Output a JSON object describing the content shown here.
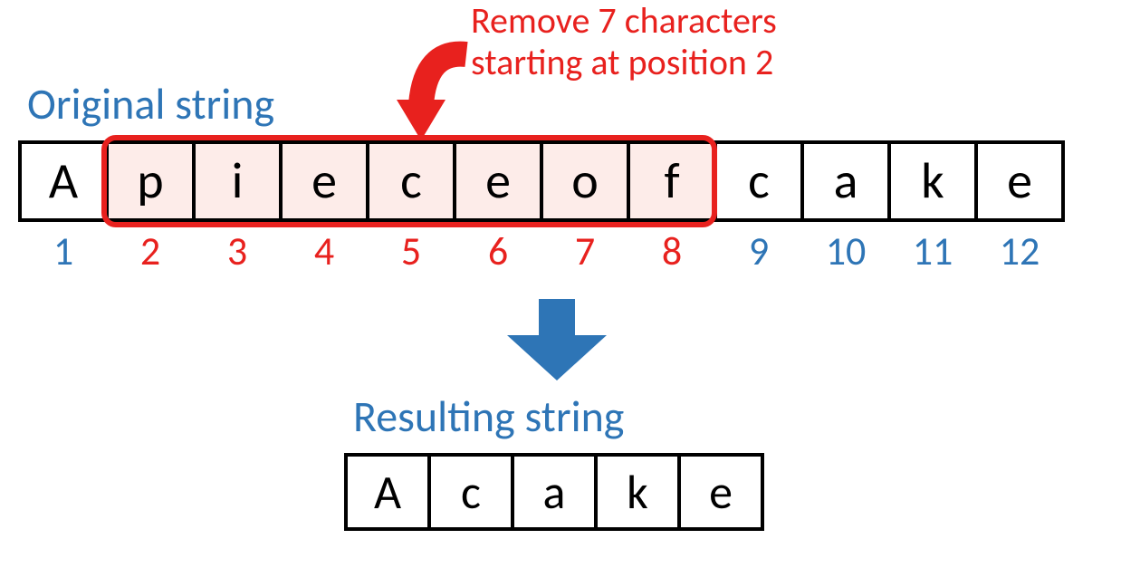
{
  "annotation": {
    "line1": "Remove 7 characters",
    "line2": "starting at position 2"
  },
  "labels": {
    "original": "Original string",
    "resulting": "Resulting string"
  },
  "original": {
    "chars": [
      "A",
      "p",
      "i",
      "e",
      "c",
      "e",
      "o",
      "f",
      "c",
      "a",
      "k",
      "e"
    ],
    "highlight_start": 2,
    "highlight_end": 8,
    "indices": [
      1,
      2,
      3,
      4,
      5,
      6,
      7,
      8,
      9,
      10,
      11,
      12
    ]
  },
  "result": {
    "chars": [
      "A",
      "c",
      "a",
      "k",
      "e"
    ]
  },
  "colors": {
    "blue": "#2e75b6",
    "red": "#e8211e",
    "highlight_fill": "#fdece9"
  }
}
